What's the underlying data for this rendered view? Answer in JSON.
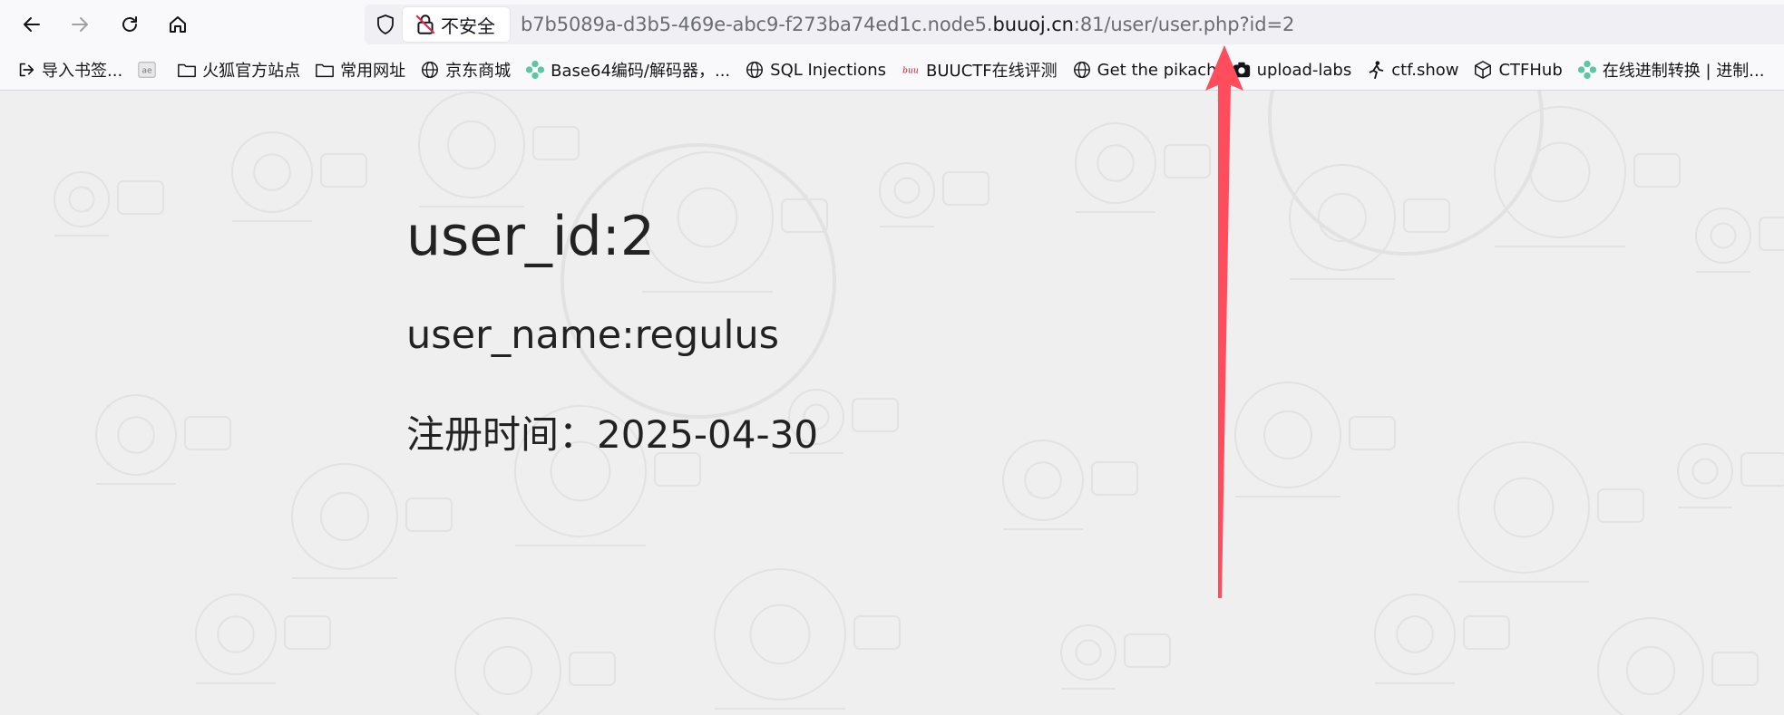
{
  "browser": {
    "nav": [
      "back-icon",
      "forward-icon",
      "reload-icon",
      "home-icon"
    ],
    "security_label": "不安全",
    "url": {
      "prefix": "b7b5089a-d3b5-469e-abc9-f273ba74ed1c.node5.",
      "domain": "buuoj.cn",
      "suffix": ":81/user/user.php?id=2"
    },
    "close_glyph": "‹"
  },
  "bookmarks": [
    {
      "label": "导入书签...",
      "icon": "import-icon"
    },
    {
      "label": "",
      "icon": "ae-icon"
    },
    {
      "label": "火狐官方站点",
      "icon": "folder-icon"
    },
    {
      "label": "常用网址",
      "icon": "folder-icon"
    },
    {
      "label": "京东商城",
      "icon": "globe-icon"
    },
    {
      "label": "Base64编码/解码器，...",
      "icon": "gear-flower-icon"
    },
    {
      "label": "SQL Injections",
      "icon": "globe-icon"
    },
    {
      "label": "BUUCTF在线评测",
      "icon": "buu-icon"
    },
    {
      "label": "Get the pikach",
      "icon": "globe-icon"
    },
    {
      "label": "upload-labs",
      "icon": "upload-icon"
    },
    {
      "label": "ctf.show",
      "icon": "runner-icon"
    },
    {
      "label": "CTFHub",
      "icon": "cube-icon"
    },
    {
      "label": "在线进制转换 | 进制...",
      "icon": "gear-flower-icon"
    }
  ],
  "page": {
    "user_id": "user_id:2",
    "user_name": "user_name:regulus",
    "reg_time": "注册时间：2025-04-30"
  },
  "colors": {
    "arrow": "#ff4d5e",
    "background": "#efefef"
  }
}
